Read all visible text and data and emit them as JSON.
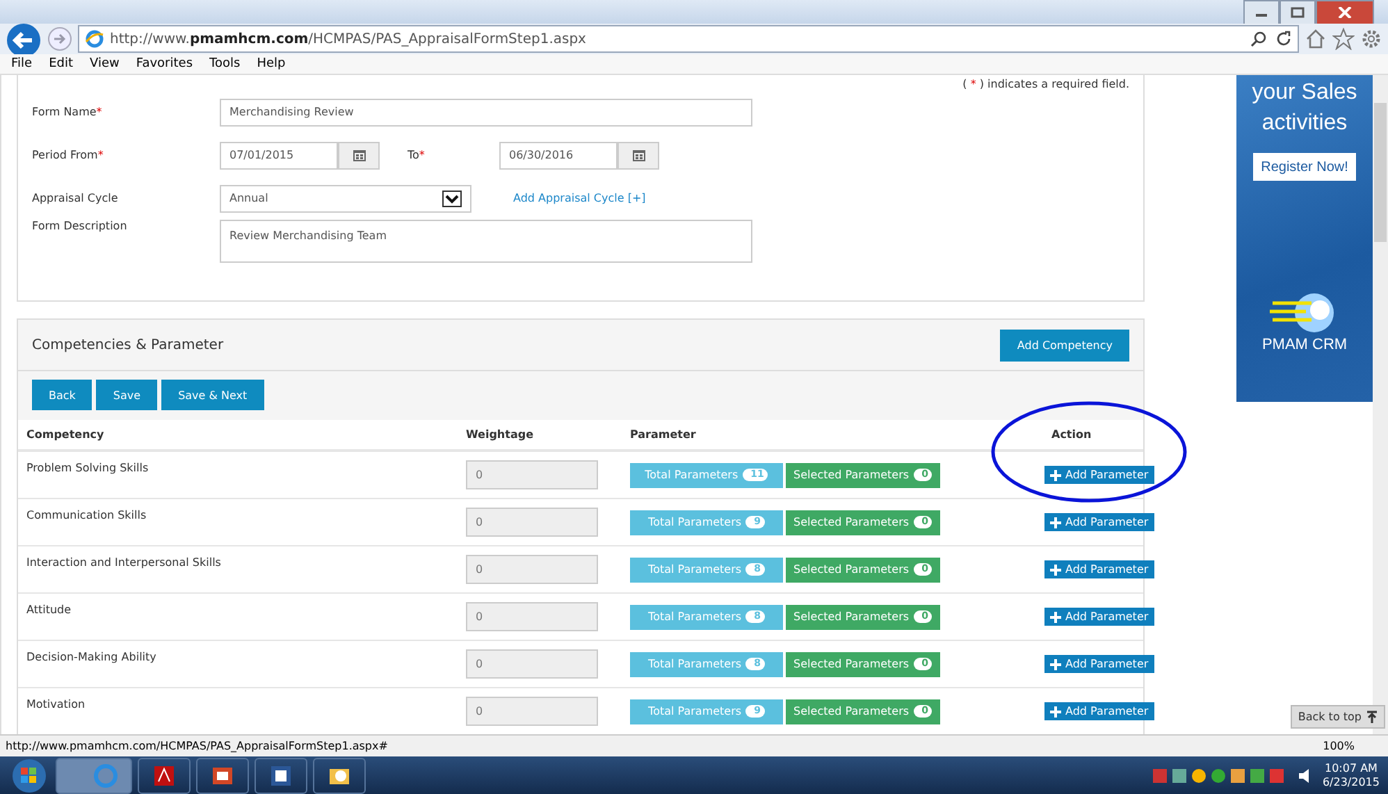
{
  "browser": {
    "url_prefix": "http://www.",
    "url_domain": "pmamhcm.com",
    "url_path": "/HCMPAS/PAS_AppraisalFormStep1.aspx",
    "menu": [
      "File",
      "Edit",
      "View",
      "Favorites",
      "Tools",
      "Help"
    ],
    "status_url": "http://www.pmamhcm.com/HCMPAS/PAS_AppraisalFormStep1.aspx#",
    "zoom": "100%"
  },
  "form": {
    "note": {
      "open": "(",
      "mark": "*",
      "text": ") indicates a required field."
    },
    "fields": [
      {
        "kind": "text",
        "label": "Form Name",
        "required_mark": "*",
        "value": "Merchandising Review"
      },
      {
        "kind": "period",
        "label": "Period From",
        "required_mark": "*",
        "value": "07/01/2015",
        "to_label": "To",
        "to_required_mark": "*",
        "to_value": "06/30/2016"
      },
      {
        "kind": "select",
        "label": "Appraisal Cycle",
        "value": "Annual",
        "link": "Add Appraisal Cycle [+]"
      },
      {
        "kind": "textarea",
        "label": "Form Description",
        "value": "Review Merchandising Team"
      }
    ]
  },
  "competencies": {
    "title": "Competencies & Parameter",
    "add_button": "Add Competency",
    "buttons": [
      "Back",
      "Save",
      "Save & Next"
    ],
    "columns": [
      "Competency",
      "Weightage",
      "Parameter",
      "Action"
    ],
    "rows": [
      {
        "name": "Problem Solving Skills",
        "weightage": "0",
        "total_label": "Total Parameters",
        "total": "11",
        "selected_label": "Selected Parameters",
        "selected": "0",
        "action": "Add Parameter",
        "highlighted": true
      },
      {
        "name": "Communication Skills",
        "weightage": "0",
        "total_label": "Total Parameters",
        "total": "9",
        "selected_label": "Selected Parameters",
        "selected": "0",
        "action": "Add Parameter",
        "highlighted": false
      },
      {
        "name": "Interaction and Interpersonal Skills",
        "weightage": "0",
        "total_label": "Total Parameters",
        "total": "8",
        "selected_label": "Selected Parameters",
        "selected": "0",
        "action": "Add Parameter",
        "highlighted": false
      },
      {
        "name": "Attitude",
        "weightage": "0",
        "total_label": "Total Parameters",
        "total": "8",
        "selected_label": "Selected Parameters",
        "selected": "0",
        "action": "Add Parameter",
        "highlighted": false
      },
      {
        "name": "Decision-Making Ability",
        "weightage": "0",
        "total_label": "Total Parameters",
        "total": "8",
        "selected_label": "Selected Parameters",
        "selected": "0",
        "action": "Add Parameter",
        "highlighted": false
      },
      {
        "name": "Motivation",
        "weightage": "0",
        "total_label": "Total Parameters",
        "total": "9",
        "selected_label": "Selected Parameters",
        "selected": "0",
        "action": "Add Parameter",
        "highlighted": false
      }
    ]
  },
  "ad": {
    "headline": "your Sales activities",
    "button": "Register Now!",
    "brand": "PMAM CRM"
  },
  "back_to_top": "Back to top",
  "taskbar": {
    "time": "10:07 AM",
    "date": "6/23/2015"
  }
}
